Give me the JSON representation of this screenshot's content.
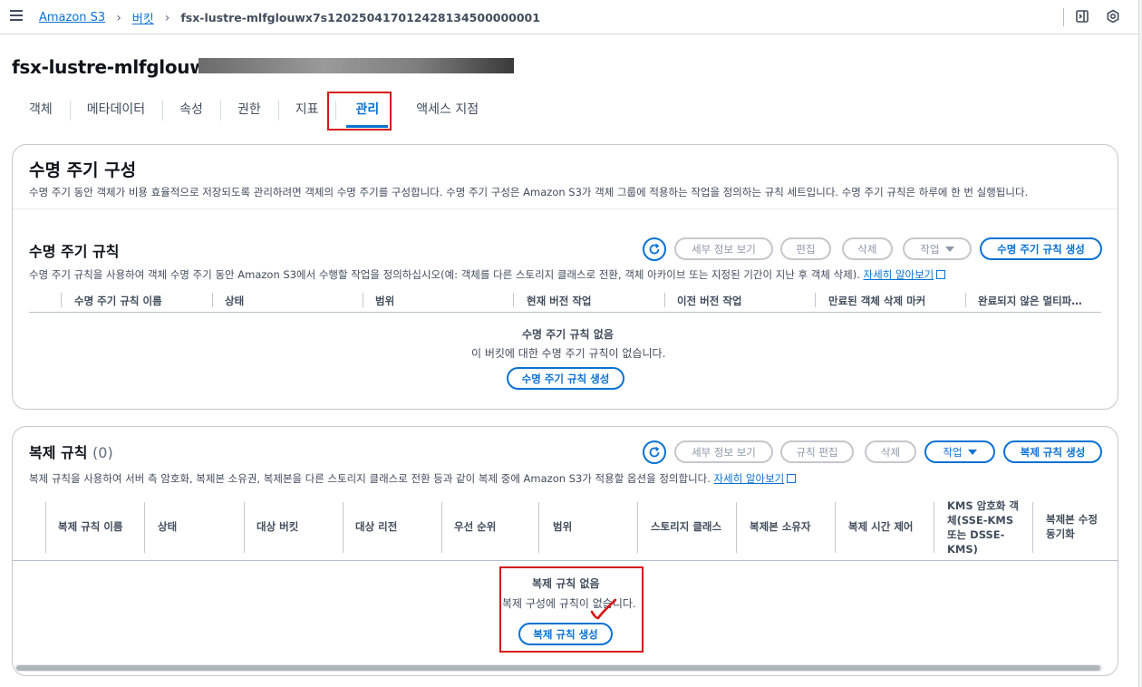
{
  "breadcrumb": {
    "items": [
      "Amazon S3",
      "버킷"
    ],
    "current": "fsx-lustre-mlfglouwx7s120250417012428134500000001"
  },
  "page": {
    "title": "fsx-lustre-mlfglouwx7"
  },
  "tabs": [
    "객체",
    "메타데이터",
    "속성",
    "권한",
    "지표",
    "관리",
    "액세스 지점"
  ],
  "active_tab": "관리",
  "lifecycle_config": {
    "title": "수명 주기 구성",
    "description": "수명 주기 동안 객체가 비용 효율적으로 저장되도록 관리하려면 객체의 수명 주기를 구성합니다. 수명 주기 구성은 Amazon S3가 객체 그룹에 적용하는 작업을 정의하는 규칙 세트입니다. 수명 주기 규칙은 하루에 한 번 실행됩니다."
  },
  "lifecycle_rules": {
    "title": "수명 주기 규칙",
    "description": "수명 주기 규칙을 사용하여 객체 수명 주기 동안 Amazon S3에서 수행할 작업을 정의하십시오(예: 객체를 다른 스토리지 클래스로 전환, 객체 아카이브 또는 지정된 기간이 지난 후 객체 삭제).",
    "learn_more": "자세히 알아보기",
    "buttons": {
      "details": "세부 정보 보기",
      "edit": "편집",
      "delete": "삭제",
      "actions": "작업",
      "create": "수명 주기 규칙 생성"
    },
    "columns": [
      "수명 주기 규칙 이름",
      "상태",
      "범위",
      "현재 버전 작업",
      "이전 버전 작업",
      "만료된 객체 삭제 마커",
      "완료되지 않은 멀티파…"
    ],
    "empty_title": "수명 주기 규칙 없음",
    "empty_desc": "이 버킷에 대한 수명 주기 규칙이 없습니다.",
    "empty_button": "수명 주기 규칙 생성"
  },
  "replication_rules": {
    "title": "복제 규칙",
    "count": "(0)",
    "description": "복제 규칙을 사용하여 서버 측 암호화, 복제본 소유권, 복제본을 다른 스토리지 클래스로 전환 등과 같이 복제 중에 Amazon S3가 적용할 옵션을 정의합니다.",
    "learn_more": "자세히 알아보기",
    "buttons": {
      "details": "세부 정보 보기",
      "edit": "규칙 편집",
      "delete": "삭제",
      "actions": "작업",
      "create": "복제 규칙 생성"
    },
    "columns": [
      "복제 규칙 이름",
      "상태",
      "대상 버킷",
      "대상 리전",
      "우선 순위",
      "범위",
      "스토리지 클래스",
      "복제본 소유자",
      "복제 시간 제어",
      "KMS 암호화 객체(SSE-KMS 또는 DSSE-KMS)",
      "복제본 수정 동기화"
    ],
    "empty_title": "복제 규칙 없음",
    "empty_desc": "복제 구성에 규칙이 없습니다.",
    "empty_button": "복제 규칙 생성"
  },
  "colors": {
    "accent": "#0972d3",
    "highlight": "#d91515"
  }
}
